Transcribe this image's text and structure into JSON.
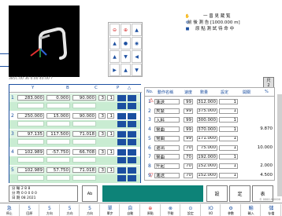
{
  "colors": {
    "accent": "#1c4fa0",
    "viewport_bg": "#000000",
    "teal_panel": "#0d8378",
    "band_green": "#c9ecd2",
    "pending": "#d62525"
  },
  "icons": {
    "shape_toolbar": [
      "minus-circle-icon",
      "plus-circle-icon",
      "arrow-up-icon",
      "arrow-up-icon",
      "circle-icon",
      "eye-icon",
      "arrow-up-icon",
      "arrow-down-icon",
      "arrow-left-icon",
      "arrow-right-icon",
      "arrow-up-icon",
      "arrow-down-icon"
    ],
    "right_top_options": [
      "hand-icon",
      "settings-icon",
      "square-icon"
    ]
  },
  "viewport": {
    "status_line": "385C.00 36 0.00 40.00 ?"
  },
  "status_panel": {
    "line1": "一 曾 見 蔵 覧",
    "line2": "前 後 測 告 [1000.000 m]",
    "line3": "原 點 測 試 待 命 中"
  },
  "side_mini_label": "尺",
  "side_mini_value": "2",
  "steps": {
    "headers": [
      "Y",
      "B",
      "C",
      "P",
      "△"
    ],
    "rows": [
      {
        "no": "1",
        "y": "283.000",
        "b": "0.000",
        "c": "90.000",
        "p": "3",
        "d": "1"
      },
      {
        "no": "2",
        "y": "250.000",
        "b": "15.000",
        "c": "90.000",
        "p": "3",
        "d": "1"
      },
      {
        "no": "3",
        "y": "97.135",
        "b": "117.500",
        "c": "71.018",
        "p": "3",
        "d": "1"
      },
      {
        "no": "4",
        "y": "102.989",
        "b": "-57.750",
        "c": "66.708",
        "p": "3",
        "d": "1"
      },
      {
        "no": "5",
        "y": "102.989",
        "b": "57.750",
        "c": "71.018",
        "p": "3",
        "d": "1"
      }
    ]
  },
  "program": {
    "headers": [
      "No.",
      "動作名稱",
      "速度",
      "數量",
      "設定",
      "開關",
      "%"
    ],
    "rows": [
      {
        "no": "1",
        "name": "進送",
        "speed": "99",
        "qty": "312.000",
        "set": "1",
        "val": ""
      },
      {
        "no": "2",
        "name": "夾緊",
        "speed": "99",
        "qty": "375.000",
        "set": "1",
        "val": ""
      },
      {
        "no": "3",
        "name": "入料",
        "speed": "99",
        "qty": "300.000",
        "set": "1",
        "val": ""
      },
      {
        "no": "4",
        "name": "彎曲",
        "speed": "99",
        "qty": "370.000",
        "set": "1",
        "val": "9.870"
      },
      {
        "no": "5",
        "name": "彎曲",
        "speed": "99",
        "qty": "171.000",
        "set": "1",
        "val": ""
      },
      {
        "no": "6",
        "name": "退出",
        "speed": "70",
        "qty": "75.000",
        "set": "1",
        "val": "10.000"
      },
      {
        "no": "7",
        "name": "彎曲",
        "speed": "70",
        "qty": "192.000",
        "set": "1",
        "val": ""
      },
      {
        "no": "8",
        "name": "升起",
        "speed": "70",
        "qty": "152.000",
        "set": "1",
        "val": "2.000"
      },
      {
        "no": "9",
        "name": "進送",
        "speed": "70",
        "qty": "152.000",
        "set": "1",
        "val": "4.500"
      }
    ]
  },
  "info_panel": {
    "line1": "分 輸 2 8 8",
    "line2": "分 時 0 0 0 0 0",
    "line3": "日 期 08 2021",
    "code": "Ab"
  },
  "right_mid_buttons": [
    "設",
    "定",
    "表"
  ],
  "bottom_bar": [
    {
      "top": "急",
      "bottom": "停止"
    },
    {
      "top": "5",
      "bottom": "回原"
    },
    {
      "top": "5",
      "bottom": "方向"
    },
    {
      "top": "5",
      "bottom": "方向"
    },
    {
      "top": "5",
      "bottom": "方向"
    },
    {
      "top": "單",
      "bottom": "單步"
    },
    {
      "top": "自",
      "bottom": "自動"
    },
    {
      "top": "⊕",
      "bottom": "原點"
    },
    {
      "top": "⊗",
      "bottom": "手動"
    },
    {
      "top": "⊙",
      "bottom": "設定"
    },
    {
      "top": "IO",
      "bottom": "I/O"
    },
    {
      "top": "⚙",
      "bottom": "參數"
    },
    {
      "top": "輸",
      "bottom": "輸入"
    },
    {
      "top": "儲",
      "bottom": "存檔"
    }
  ],
  "copyright": "© 0000.9.0000"
}
